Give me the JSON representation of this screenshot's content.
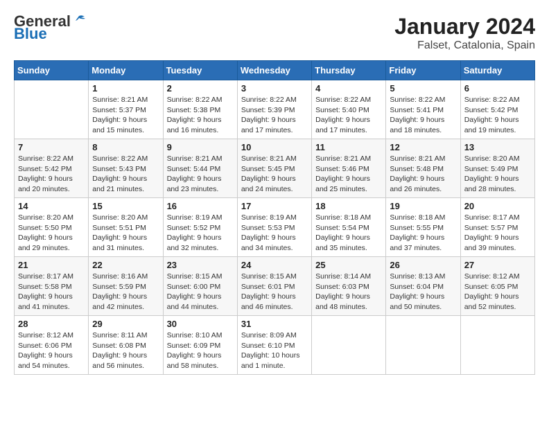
{
  "header": {
    "logo_general": "General",
    "logo_blue": "Blue",
    "title": "January 2024",
    "subtitle": "Falset, Catalonia, Spain"
  },
  "weekdays": [
    "Sunday",
    "Monday",
    "Tuesday",
    "Wednesday",
    "Thursday",
    "Friday",
    "Saturday"
  ],
  "weeks": [
    [
      {
        "day": "",
        "info": ""
      },
      {
        "day": "1",
        "info": "Sunrise: 8:21 AM\nSunset: 5:37 PM\nDaylight: 9 hours\nand 15 minutes."
      },
      {
        "day": "2",
        "info": "Sunrise: 8:22 AM\nSunset: 5:38 PM\nDaylight: 9 hours\nand 16 minutes."
      },
      {
        "day": "3",
        "info": "Sunrise: 8:22 AM\nSunset: 5:39 PM\nDaylight: 9 hours\nand 17 minutes."
      },
      {
        "day": "4",
        "info": "Sunrise: 8:22 AM\nSunset: 5:40 PM\nDaylight: 9 hours\nand 17 minutes."
      },
      {
        "day": "5",
        "info": "Sunrise: 8:22 AM\nSunset: 5:41 PM\nDaylight: 9 hours\nand 18 minutes."
      },
      {
        "day": "6",
        "info": "Sunrise: 8:22 AM\nSunset: 5:42 PM\nDaylight: 9 hours\nand 19 minutes."
      }
    ],
    [
      {
        "day": "7",
        "info": "Sunrise: 8:22 AM\nSunset: 5:42 PM\nDaylight: 9 hours\nand 20 minutes."
      },
      {
        "day": "8",
        "info": "Sunrise: 8:22 AM\nSunset: 5:43 PM\nDaylight: 9 hours\nand 21 minutes."
      },
      {
        "day": "9",
        "info": "Sunrise: 8:21 AM\nSunset: 5:44 PM\nDaylight: 9 hours\nand 23 minutes."
      },
      {
        "day": "10",
        "info": "Sunrise: 8:21 AM\nSunset: 5:45 PM\nDaylight: 9 hours\nand 24 minutes."
      },
      {
        "day": "11",
        "info": "Sunrise: 8:21 AM\nSunset: 5:46 PM\nDaylight: 9 hours\nand 25 minutes."
      },
      {
        "day": "12",
        "info": "Sunrise: 8:21 AM\nSunset: 5:48 PM\nDaylight: 9 hours\nand 26 minutes."
      },
      {
        "day": "13",
        "info": "Sunrise: 8:20 AM\nSunset: 5:49 PM\nDaylight: 9 hours\nand 28 minutes."
      }
    ],
    [
      {
        "day": "14",
        "info": "Sunrise: 8:20 AM\nSunset: 5:50 PM\nDaylight: 9 hours\nand 29 minutes."
      },
      {
        "day": "15",
        "info": "Sunrise: 8:20 AM\nSunset: 5:51 PM\nDaylight: 9 hours\nand 31 minutes."
      },
      {
        "day": "16",
        "info": "Sunrise: 8:19 AM\nSunset: 5:52 PM\nDaylight: 9 hours\nand 32 minutes."
      },
      {
        "day": "17",
        "info": "Sunrise: 8:19 AM\nSunset: 5:53 PM\nDaylight: 9 hours\nand 34 minutes."
      },
      {
        "day": "18",
        "info": "Sunrise: 8:18 AM\nSunset: 5:54 PM\nDaylight: 9 hours\nand 35 minutes."
      },
      {
        "day": "19",
        "info": "Sunrise: 8:18 AM\nSunset: 5:55 PM\nDaylight: 9 hours\nand 37 minutes."
      },
      {
        "day": "20",
        "info": "Sunrise: 8:17 AM\nSunset: 5:57 PM\nDaylight: 9 hours\nand 39 minutes."
      }
    ],
    [
      {
        "day": "21",
        "info": "Sunrise: 8:17 AM\nSunset: 5:58 PM\nDaylight: 9 hours\nand 41 minutes."
      },
      {
        "day": "22",
        "info": "Sunrise: 8:16 AM\nSunset: 5:59 PM\nDaylight: 9 hours\nand 42 minutes."
      },
      {
        "day": "23",
        "info": "Sunrise: 8:15 AM\nSunset: 6:00 PM\nDaylight: 9 hours\nand 44 minutes."
      },
      {
        "day": "24",
        "info": "Sunrise: 8:15 AM\nSunset: 6:01 PM\nDaylight: 9 hours\nand 46 minutes."
      },
      {
        "day": "25",
        "info": "Sunrise: 8:14 AM\nSunset: 6:03 PM\nDaylight: 9 hours\nand 48 minutes."
      },
      {
        "day": "26",
        "info": "Sunrise: 8:13 AM\nSunset: 6:04 PM\nDaylight: 9 hours\nand 50 minutes."
      },
      {
        "day": "27",
        "info": "Sunrise: 8:12 AM\nSunset: 6:05 PM\nDaylight: 9 hours\nand 52 minutes."
      }
    ],
    [
      {
        "day": "28",
        "info": "Sunrise: 8:12 AM\nSunset: 6:06 PM\nDaylight: 9 hours\nand 54 minutes."
      },
      {
        "day": "29",
        "info": "Sunrise: 8:11 AM\nSunset: 6:08 PM\nDaylight: 9 hours\nand 56 minutes."
      },
      {
        "day": "30",
        "info": "Sunrise: 8:10 AM\nSunset: 6:09 PM\nDaylight: 9 hours\nand 58 minutes."
      },
      {
        "day": "31",
        "info": "Sunrise: 8:09 AM\nSunset: 6:10 PM\nDaylight: 10 hours\nand 1 minute."
      },
      {
        "day": "",
        "info": ""
      },
      {
        "day": "",
        "info": ""
      },
      {
        "day": "",
        "info": ""
      }
    ]
  ]
}
